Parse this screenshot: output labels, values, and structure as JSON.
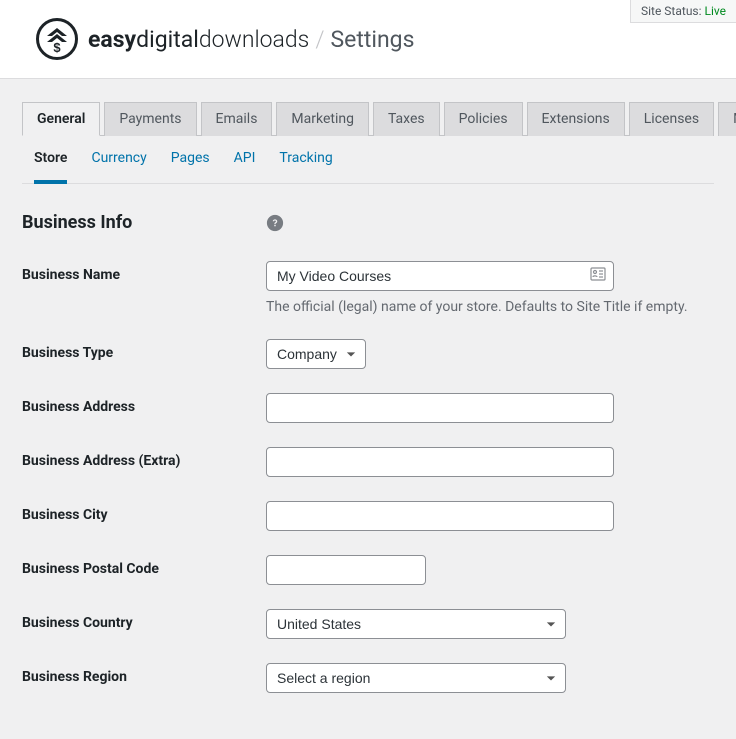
{
  "site_status": {
    "label": "Site Status:",
    "value": "Live"
  },
  "header": {
    "brand_easy": "easy",
    "brand_digital": "digital",
    "brand_downloads": "downloads",
    "slash": "/",
    "page_title": "Settings"
  },
  "tabs": [
    {
      "label": "General",
      "active": true
    },
    {
      "label": "Payments"
    },
    {
      "label": "Emails"
    },
    {
      "label": "Marketing"
    },
    {
      "label": "Taxes"
    },
    {
      "label": "Policies"
    },
    {
      "label": "Extensions"
    },
    {
      "label": "Licenses"
    },
    {
      "label": "Misc"
    }
  ],
  "subtabs": [
    {
      "label": "Store",
      "active": true
    },
    {
      "label": "Currency"
    },
    {
      "label": "Pages"
    },
    {
      "label": "API"
    },
    {
      "label": "Tracking"
    }
  ],
  "section": {
    "title": "Business Info"
  },
  "fields": {
    "business_name": {
      "label": "Business Name",
      "value": "My Video Courses",
      "help": "The official (legal) name of your store. Defaults to Site Title if empty."
    },
    "business_type": {
      "label": "Business Type",
      "value": "Company"
    },
    "business_address": {
      "label": "Business Address",
      "value": ""
    },
    "business_address_extra": {
      "label": "Business Address (Extra)",
      "value": ""
    },
    "business_city": {
      "label": "Business City",
      "value": ""
    },
    "business_postal_code": {
      "label": "Business Postal Code",
      "value": ""
    },
    "business_country": {
      "label": "Business Country",
      "value": "United States"
    },
    "business_region": {
      "label": "Business Region",
      "value": "Select a region"
    }
  }
}
